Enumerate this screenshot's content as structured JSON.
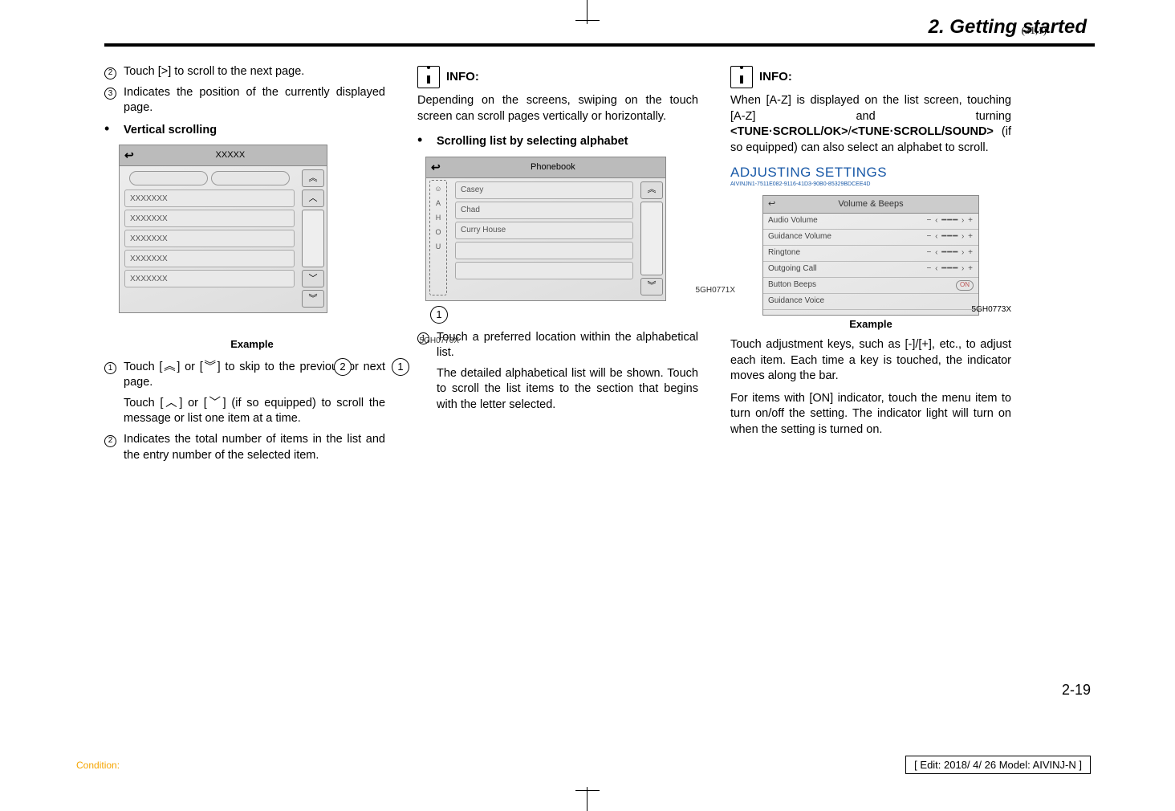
{
  "coord_top": "(31,1)",
  "section_header": "2. Getting started",
  "col1": {
    "li2": "Touch [>] to scroll to the next page.",
    "li3": "Indicates the position of the currently displayed page.",
    "vertical_scrolling": "Vertical scrolling",
    "fig": {
      "title": "XXXXX",
      "row": "XXXXXXX",
      "code": "5GH0770X",
      "example": "Example"
    },
    "p1a": "Touch [",
    "p1b": "] or [",
    "p1c": "] to skip to the previous or next page.",
    "p1d": "Touch [",
    "p1e": "] or [",
    "p1f": "] (if so equipped) to scroll the message or list one item at a time.",
    "p2": "Indicates the total number of items in the list and the entry number of the selected item."
  },
  "col2": {
    "info_title": "INFO:",
    "info_body": "Depending on the screens, swiping on the touch screen can scroll pages vertically or horizontally.",
    "scroll_alpha": "Scrolling list by selecting alphabet",
    "fig": {
      "title": "Phonebook",
      "rows": [
        "Casey",
        "Chad",
        "Curry House"
      ],
      "code": "5GH0771X"
    },
    "p1": "Touch a preferred location within the alphabetical list.",
    "p2": "The detailed alphabetical list will be shown. Touch to scroll the list items to the section that begins with the letter selected."
  },
  "col3": {
    "info_title": "INFO:",
    "info_body_a": "When [A-Z] is displayed on the list screen, touching [A-Z] and turning ",
    "info_body_b": "<TUNE·SCROLL/OK>",
    "info_body_c": "/",
    "info_body_d": "<TUNE·SCROLL/SOUND>",
    "info_body_e": " (if so equipped) can also select an alphabet to scroll.",
    "adjusting": "ADJUSTING SETTINGS",
    "adjusting_hash": "AIVINJN1-7511E082-9116-41D3-90B0-85329BDCEE4D",
    "fig": {
      "title": "Volume & Beeps",
      "rows": [
        "Audio Volume",
        "Guidance Volume",
        "Ringtone",
        "Outgoing Call",
        "Button Beeps",
        "Guidance Voice"
      ],
      "on": "ON",
      "code": "5GH0773X",
      "example": "Example"
    },
    "p1": "Touch adjustment keys, such as [-]/[+], etc., to adjust each item. Each time a key is touched, the indicator moves along the bar.",
    "p2": "For items with [ON] indicator, touch the menu item to turn on/off the setting. The indicator light will turn on when the setting is turned on."
  },
  "page_number": "2-19",
  "footer_condition": "Condition:",
  "footer_edit": "[ Edit: 2018/ 4/ 26   Model: AIVINJ-N ]"
}
